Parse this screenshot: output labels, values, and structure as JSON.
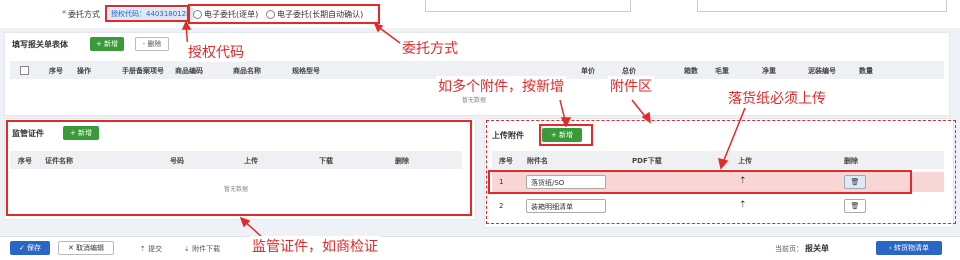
{
  "top": {
    "required_mark": "*",
    "delegation_label": "委托方式",
    "auth_code": "授权代码：4403180128",
    "option1": "电子委托(逐单)",
    "option2": "电子委托(长期自动确认)"
  },
  "declaration": {
    "title": "填写报关单表体",
    "add_label": "+ 新增",
    "delete_label": "- 删除",
    "columns": [
      "序号",
      "操作",
      "手册备案项号",
      "商品编码",
      "商品名称",
      "规格型号",
      "单价",
      "总价",
      "箱数",
      "毛重",
      "净重",
      "泥装编号",
      "数量"
    ],
    "empty_text": "暂无数据"
  },
  "supervision": {
    "title": "监管证件",
    "add_label": "+ 新增",
    "columns": [
      "序号",
      "证件名称",
      "号码",
      "上传",
      "下载",
      "删除"
    ],
    "empty_text": "暂无数据"
  },
  "upload": {
    "title": "上传附件",
    "add_label": "+ 新增",
    "columns": [
      "序号",
      "附件名",
      "PDF下载",
      "上传",
      "删除"
    ],
    "rows": [
      {
        "index": "1",
        "name": "落货纸/SO"
      },
      {
        "index": "2",
        "name": "装箱明细清单"
      }
    ]
  },
  "annotations": {
    "auth_code": "授权代码",
    "delegation": "委托方式",
    "add_more": "如多个附件，按新增",
    "attach_area": "附件区",
    "so_required": "落货纸必须上传",
    "supervision": "监管证件，如商检证"
  },
  "footer": {
    "save": "保存",
    "cancel": "取消编辑",
    "submit": "提交",
    "download": "附件下载",
    "current_page_label": "当前页：",
    "current_page": "报关单",
    "transfer": "转货物清单"
  },
  "colors": {
    "annotation_red": "#e12a2a",
    "green": "#3a9a3a",
    "blue": "#2a66c4",
    "highlight_row": "#f9d6d6"
  },
  "icons": {
    "upload": "upload-icon",
    "delete": "trash-icon"
  }
}
